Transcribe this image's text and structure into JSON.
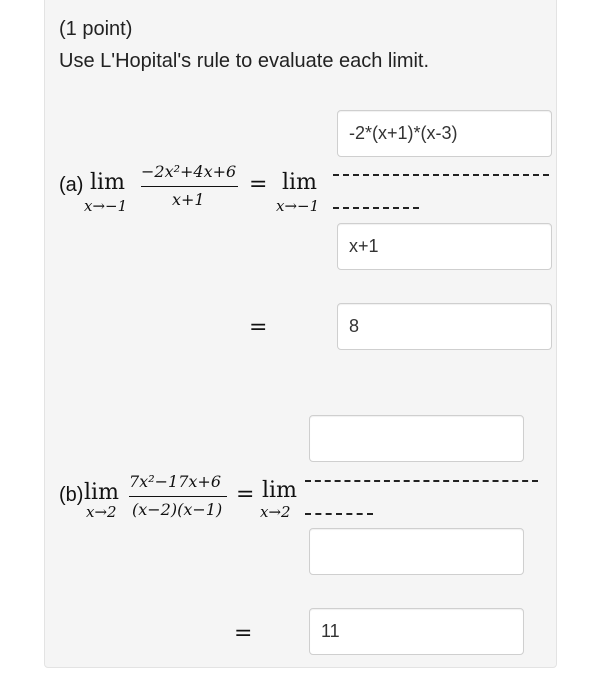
{
  "header": {
    "points": "(1 point)",
    "instruction": "Use L'Hopital's rule to evaluate each limit."
  },
  "part_a": {
    "label": "(a)",
    "lim": "lim",
    "approach": "x→−1",
    "numerator": "−2x²+4x+6",
    "denominator": "x+1",
    "equals": "=",
    "answer_numerator": "-2*(x+1)*(x-3)",
    "answer_denominator": "x+1",
    "answer_value": "8"
  },
  "part_b": {
    "label": "(b)",
    "lim": "lim",
    "approach": "x→2",
    "numerator": "7x²−17x+6",
    "denominator": "(x−2)(x−1)",
    "equals": "=",
    "answer_numerator": "",
    "answer_denominator": "",
    "answer_value": "11"
  }
}
